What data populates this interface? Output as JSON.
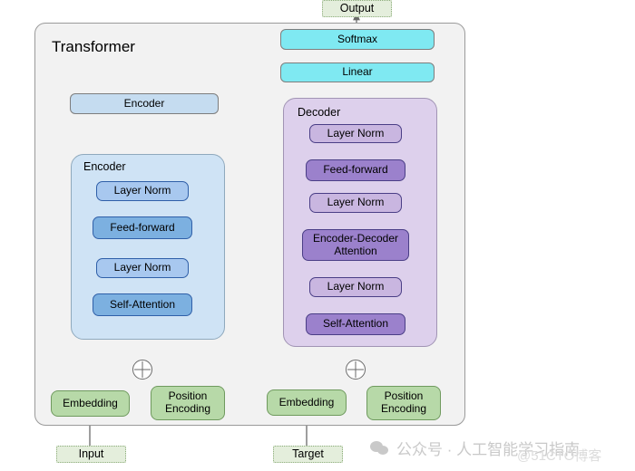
{
  "diagram": {
    "title": "Transformer",
    "outer_label": "Transformer",
    "containers": {
      "encoder_group_label": "Encoder",
      "decoder_group_label": "Decoder"
    },
    "io": {
      "output": "Output",
      "input": "Input",
      "target": "Target"
    },
    "head": {
      "softmax": "Softmax",
      "linear": "Linear"
    },
    "encoder_summary": "Encoder",
    "encoder_blocks": [
      {
        "label": "Layer Norm",
        "kind": "layernorm"
      },
      {
        "label": "Feed-forward",
        "kind": "sublayer"
      },
      {
        "label": "Layer Norm",
        "kind": "layernorm"
      },
      {
        "label": "Self-Attention",
        "kind": "sublayer"
      }
    ],
    "decoder_blocks": [
      {
        "label": "Layer Norm",
        "kind": "layernorm"
      },
      {
        "label": "Feed-forward",
        "kind": "sublayer"
      },
      {
        "label": "Layer Norm",
        "kind": "layernorm"
      },
      {
        "label": "Encoder-Decoder\nAttention",
        "kind": "sublayer"
      },
      {
        "label": "Layer Norm",
        "kind": "layernorm"
      },
      {
        "label": "Self-Attention",
        "kind": "sublayer"
      }
    ],
    "source_stack": {
      "embedding": "Embedding",
      "position_encoding": "Position\nEncoding",
      "operator": "+"
    },
    "target_stack": {
      "embedding": "Embedding",
      "position_encoding": "Position\nEncoding",
      "operator": "+"
    },
    "colors": {
      "canvas": "#ffffff",
      "outer_fill": "#f2f2f2",
      "encoder_group_fill": "#cfe3f5",
      "decoder_group_fill": "#ddd0ec",
      "layernorm_encoder": "#a8c8ef",
      "sublayer_encoder": "#7cb0e0",
      "layernorm_decoder": "#c9b6e0",
      "sublayer_decoder": "#9b81cc",
      "encoder_summary_fill": "#c5dcf0",
      "head_fill": "#7fe9f2",
      "embedding_fill": "#b7d9a8",
      "io_fill": "#e4eedc",
      "wire": "#6a6a6a"
    }
  },
  "watermark": {
    "text": "公众号 · 人工智能学习指南",
    "icon": "wechat-icon",
    "overlay": "@51CTO博客"
  }
}
